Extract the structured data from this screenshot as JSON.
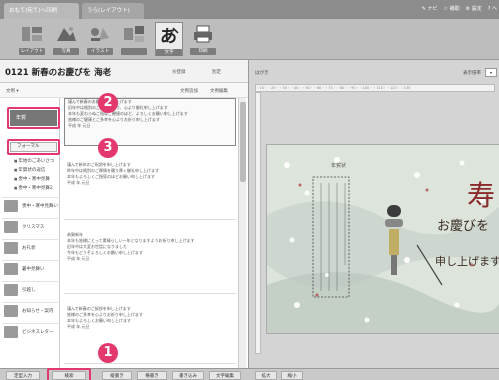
{
  "tabs": [
    "おもて(宛て)へ印刷",
    "うら(レイアウト)"
  ],
  "top_links": [
    "ナビ",
    "補助",
    "設定",
    "ヘ"
  ],
  "tools": [
    {
      "label": "レイアウト",
      "icon": "layout-icon"
    },
    {
      "label": "写真",
      "icon": "photo-icon"
    },
    {
      "label": "イラスト",
      "icon": "illustration-icon"
    },
    {
      "label": "文字",
      "icon": "text-icon"
    },
    {
      "label": "印刷",
      "icon": "print-icon"
    }
  ],
  "doc": {
    "title": "0121 新春のお慶びを 海老",
    "link1": "Ⓜ登録",
    "link2": "別定"
  },
  "subbar": {
    "left": "文例 ▾",
    "right1": "文例追加",
    "right2": "文例編集"
  },
  "category": {
    "selected": "年賀",
    "sub": "フォーマル"
  },
  "subitems": [
    "年始のごあいさつ",
    "年賀状の返信",
    "喪中・寒中見舞",
    "喪中・寒中見舞2"
  ],
  "categories": [
    "喪中・寒中見舞い",
    "クリスマス",
    "お礼状",
    "暑中見舞い",
    "引越し",
    "お知らせ・案内",
    "ビジネスレター"
  ],
  "samples": [
    [
      "謹んで新春のお慶びを申し上げます",
      "旧年中は格別のご厚情を賜り、心より御礼申し上げます",
      "本年も変わらぬご指導ご鞭撻のほど、よろしくお願い申し上げます",
      "皆様のご健康とご多幸を心よりお祈り申し上げます",
      "",
      "平成 年 元旦"
    ],
    [
      "謹んで新年のご祝詞を申し上げます",
      "昨年中は格別のご厚情を賜り厚く御礼申し上げます",
      "本年もよろしくご指導のほどお願い申し上げます",
      "平成 年 元旦"
    ],
    [
      "恭賀新年",
      "本年も皆様にとって素晴らしい一年となりますようお祈り申し上げます",
      "旧年中は大変お世話になりました",
      "今年もどうぞよろしくお願い申し上げます",
      "平成 年 元旦"
    ],
    [
      "謹んで新春のご挨拶を申し上げます",
      "皆様のご多幸を心よりお祈り申し上げます",
      "本年もよろしくお願い申し上げます",
      "平成 年 元旦"
    ]
  ],
  "preview": {
    "title": "はがき",
    "opt": "表示倍率",
    "zoom": "▾",
    "ruler": "・10・・20・・30・・40・・50・・60・・70・・80・・90・・100・・110・・120・・130",
    "card_big_text": "寿",
    "card_vtext": [
      "お慶びを",
      "申し上げます"
    ],
    "card_label": "年賀状"
  },
  "bottom_buttons": [
    "定型入力",
    "検索",
    "縦書き",
    "横書き",
    "書き込み",
    "文字編集"
  ],
  "bottom_right": [
    "拡大",
    "縮小"
  ],
  "badges": [
    "1",
    "2",
    "3"
  ],
  "colors": {
    "accent": "#e2386d",
    "toolbar": "#bdbdbd"
  }
}
